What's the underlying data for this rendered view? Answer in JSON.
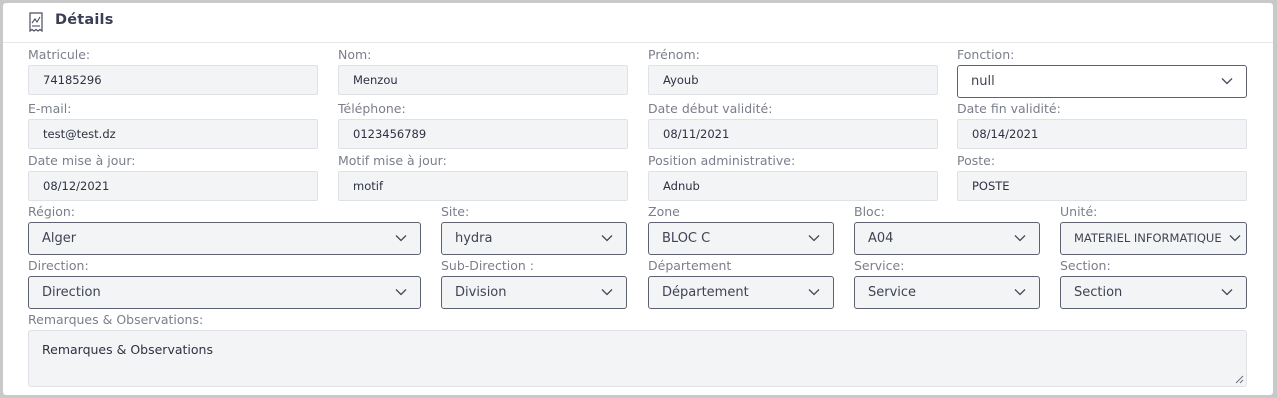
{
  "header": {
    "title": "Détails",
    "icon": "receipt-icon"
  },
  "row1": {
    "matricule": {
      "label": "Matricule:",
      "value": "74185296"
    },
    "nom": {
      "label": "Nom:",
      "value": "Menzou"
    },
    "prenom": {
      "label": "Prénom:",
      "value": "Ayoub"
    },
    "fonction": {
      "label": "Fonction:",
      "value": "null"
    }
  },
  "row2": {
    "email": {
      "label": "E-mail:",
      "value": "test@test.dz"
    },
    "telephone": {
      "label": "Téléphone:",
      "value": "0123456789"
    },
    "date_debut": {
      "label": "Date début validité:",
      "value": "08/11/2021"
    },
    "date_fin": {
      "label": "Date fin validité:",
      "value": "08/14/2021"
    }
  },
  "row3": {
    "date_maj": {
      "label": "Date mise à jour:",
      "value": "08/12/2021"
    },
    "motif_maj": {
      "label": "Motif mise à jour:",
      "value": "motif"
    },
    "position": {
      "label": "Position administrative:",
      "value": "Adnub"
    },
    "poste": {
      "label": "Poste:",
      "value": "POSTE"
    }
  },
  "row4": {
    "region": {
      "label": "Région:",
      "value": "Alger"
    },
    "site": {
      "label": "Site:",
      "value": "hydra"
    },
    "zone": {
      "label": "Zone",
      "value": "BLOC C"
    },
    "bloc": {
      "label": "Bloc:",
      "value": "A04"
    },
    "unite": {
      "label": "Unité:",
      "value": "MATERIEL INFORMATIQUE"
    }
  },
  "row5": {
    "direction": {
      "label": "Direction:",
      "value": "Direction"
    },
    "sub_direction": {
      "label": "Sub-Direction :",
      "value": "Division"
    },
    "departement": {
      "label": "Département",
      "value": "Département"
    },
    "service": {
      "label": "Service:",
      "value": "Service"
    },
    "section": {
      "label": "Section:",
      "value": "Section"
    }
  },
  "remarques": {
    "label": "Remarques & Observations:",
    "placeholder": "Remarques & Observations"
  }
}
